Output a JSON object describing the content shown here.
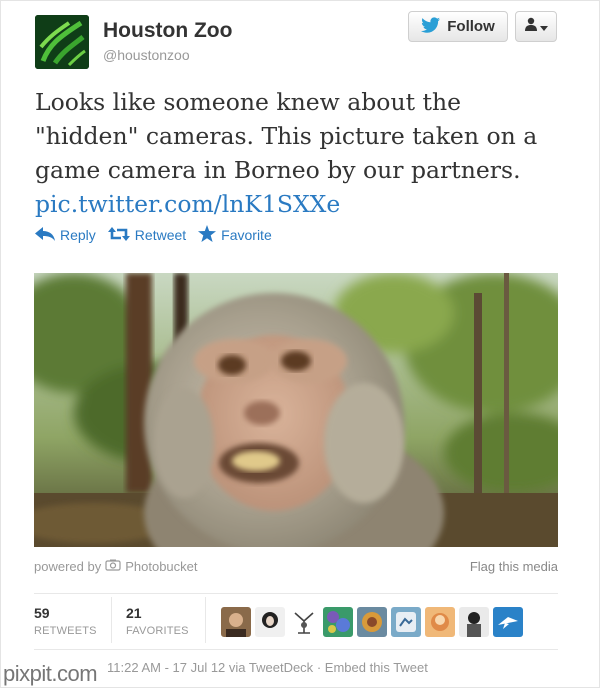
{
  "header": {
    "name": "Houston Zoo",
    "handle": "@houstonzoo",
    "follow_label": "Follow"
  },
  "tweet": {
    "lines": [
      "Looks like someone knew about the",
      "\"hidden\" cameras. This picture taken on a",
      "game camera in Borneo by our partners."
    ],
    "link": "pic.twitter.com/lnK1SXXe"
  },
  "actions": {
    "reply": "Reply",
    "retweet": "Retweet",
    "favorite": "Favorite"
  },
  "media": {
    "powered_by": "powered by",
    "provider": "Photobucket",
    "flag": "Flag this media"
  },
  "stats": {
    "retweets": "59",
    "retweets_label": "RETWEETS",
    "favorites": "21",
    "favorites_label": "FAVORITES"
  },
  "meta": {
    "time": "11:22 AM - 17 Jul 12 via TweetDeck",
    "sep": "·",
    "embed": "Embed this Tweet"
  },
  "watermark": "pixpit.com",
  "colors": {
    "link": "#2a7ac2",
    "muted": "#999999",
    "twitter_bird": "#2a9fd6",
    "logo_bg": "#0f3d17"
  },
  "icons": {
    "follow": "bird-icon",
    "user_menu": "user-icon",
    "reply": "reply-arrow-icon",
    "retweet": "retweet-icon",
    "favorite": "star-icon",
    "photobucket": "camera-icon"
  }
}
